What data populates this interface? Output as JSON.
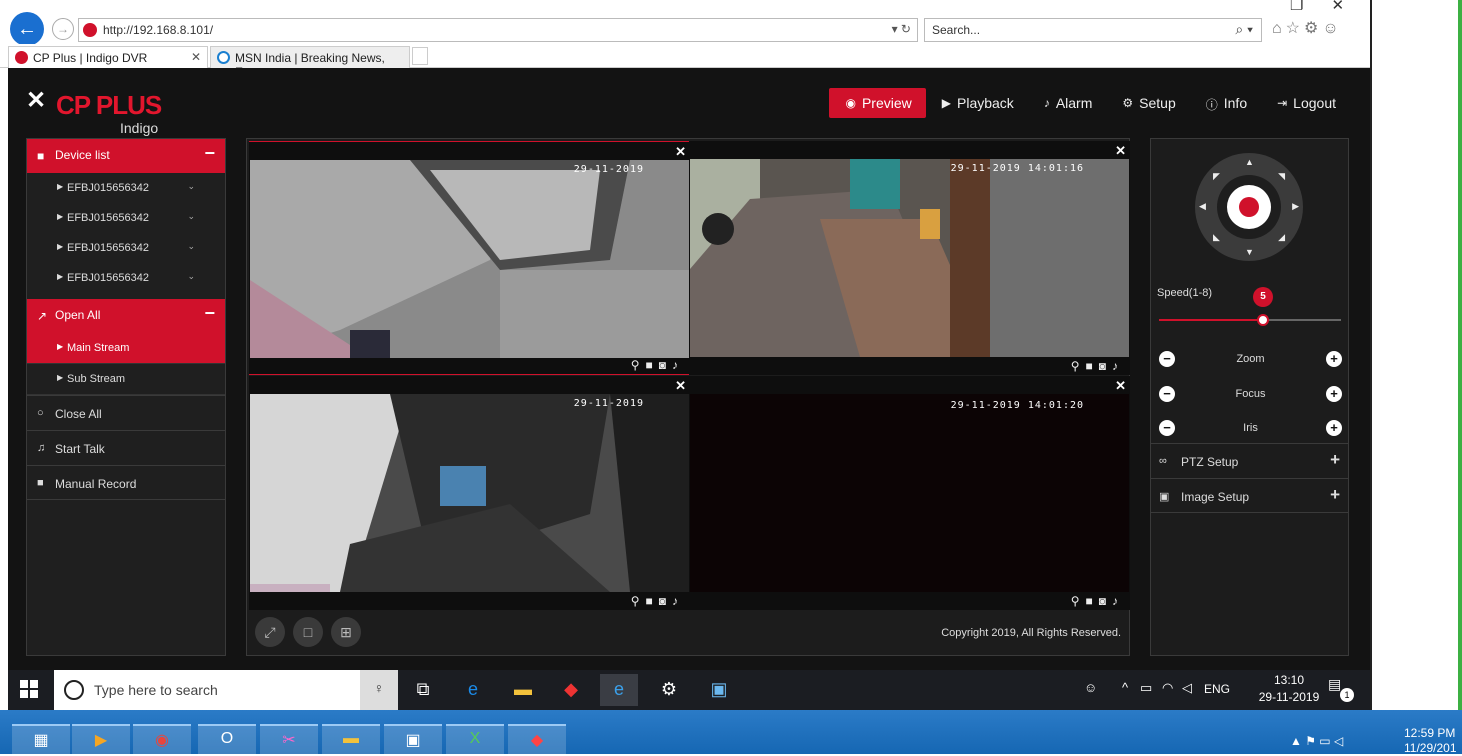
{
  "browser": {
    "url": "http://192.168.8.101/",
    "search_placeholder": "Search...",
    "tabs": [
      {
        "title": "CP Plus | Indigo DVR"
      },
      {
        "title": "MSN India | Breaking News, En..."
      }
    ]
  },
  "app": {
    "logo_brand": "CP PLUS",
    "logo_sub": "Indigo",
    "nav": [
      {
        "label": "Preview",
        "icon": "eye-icon",
        "active": true
      },
      {
        "label": "Playback",
        "icon": "play-circle-icon"
      },
      {
        "label": "Alarm",
        "icon": "bell-icon"
      },
      {
        "label": "Setup",
        "icon": "gear-icon"
      },
      {
        "label": "Info",
        "icon": "info-icon"
      },
      {
        "label": "Logout",
        "icon": "logout-icon"
      }
    ],
    "sidebar": {
      "device_list_label": "Device list",
      "devices": [
        "EFBJ015656342",
        "EFBJ015656342",
        "EFBJ015656342",
        "EFBJ015656342"
      ],
      "open_all_label": "Open All",
      "streams": [
        "Main Stream",
        "Sub Stream"
      ],
      "close_all_label": "Close All",
      "start_talk_label": "Start Talk",
      "manual_record_label": "Manual Record"
    },
    "video": {
      "cells": [
        {
          "timestamp": "29-11-2019"
        },
        {
          "timestamp": "29-11-2019 14:01:16"
        },
        {
          "timestamp": "29-11-2019"
        },
        {
          "timestamp": "29-11-2019 14:01:20"
        }
      ],
      "copyright": "Copyright 2019, All Rights Reserved."
    },
    "ptz": {
      "speed_label": "Speed(1-8)",
      "speed_value": "5",
      "speed_min": 1,
      "speed_max": 8,
      "controls": [
        "Zoom",
        "Focus",
        "Iris"
      ],
      "ptz_setup_label": "PTZ Setup",
      "image_setup_label": "Image Setup"
    }
  },
  "taskbar": {
    "search_placeholder": "Type here to search",
    "lang": "ENG",
    "time": "13:10",
    "date": "29-11-2019",
    "notification_count": "1"
  },
  "host_taskbar": {
    "time": "12:59 PM",
    "date": "11/29/201"
  },
  "colors": {
    "accent": "#d0112b",
    "app_bg": "#131313"
  }
}
